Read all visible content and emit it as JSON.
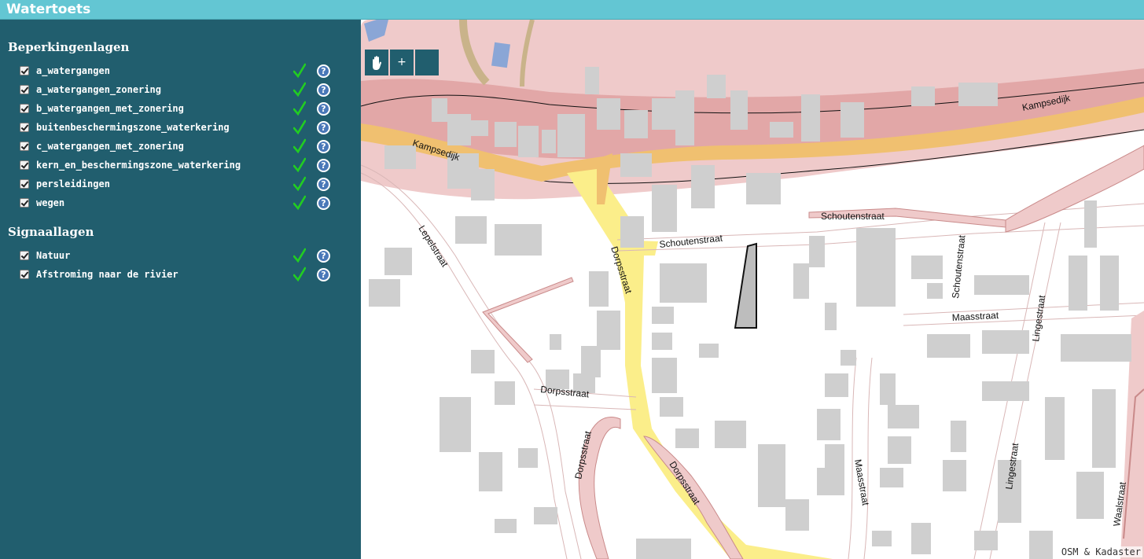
{
  "app": {
    "title": "Watertoets"
  },
  "sidebar": {
    "restriction_title": "Beperkingenlagen",
    "restriction_layers": [
      {
        "label": "a_watergangen",
        "checked": true,
        "status": "ok"
      },
      {
        "label": "a_watergangen_zonering",
        "checked": true,
        "status": "ok"
      },
      {
        "label": "b_watergangen_met_zonering",
        "checked": true,
        "status": "ok"
      },
      {
        "label": "buitenbeschermingszone_waterkering",
        "checked": true,
        "status": "ok"
      },
      {
        "label": "c_watergangen_met_zonering",
        "checked": true,
        "status": "ok"
      },
      {
        "label": "kern_en_beschermingszone_waterkering",
        "checked": true,
        "status": "ok"
      },
      {
        "label": "persleidingen",
        "checked": true,
        "status": "ok"
      },
      {
        "label": "wegen",
        "checked": true,
        "status": "ok"
      }
    ],
    "signal_title": "Signaallagen",
    "signal_layers": [
      {
        "label": "Natuur",
        "checked": true,
        "status": "ok"
      },
      {
        "label": "Afstroming naar de rivier",
        "checked": true,
        "status": "ok"
      }
    ],
    "help_glyph": "?"
  },
  "map": {
    "zoom_out_label": "-",
    "zoom_in_label": "+",
    "pan_icon": "hand-icon",
    "attribution": "OSM & Kadaster",
    "streets": {
      "kampsedijk": "Kampsedijk",
      "schoutenstraat": "Schoutenstraat",
      "dorpsstraat": "Dorpsstraat",
      "lepelstraat": "Lepelstraat",
      "maasstraat": "Maasstraat",
      "lingestraat": "Lingestraat",
      "waalstraat": "Waalstraat"
    }
  },
  "colors": {
    "header": "#63c6d3",
    "sidebar": "#215e6e",
    "check": "#22cc22",
    "help": "#4a78b8",
    "dike_zone": "#efcaca",
    "dike_core": "#dd9b9b",
    "main_road": "#f0c070",
    "local_road": "#fbee8a",
    "building": "#cfcfcf"
  }
}
